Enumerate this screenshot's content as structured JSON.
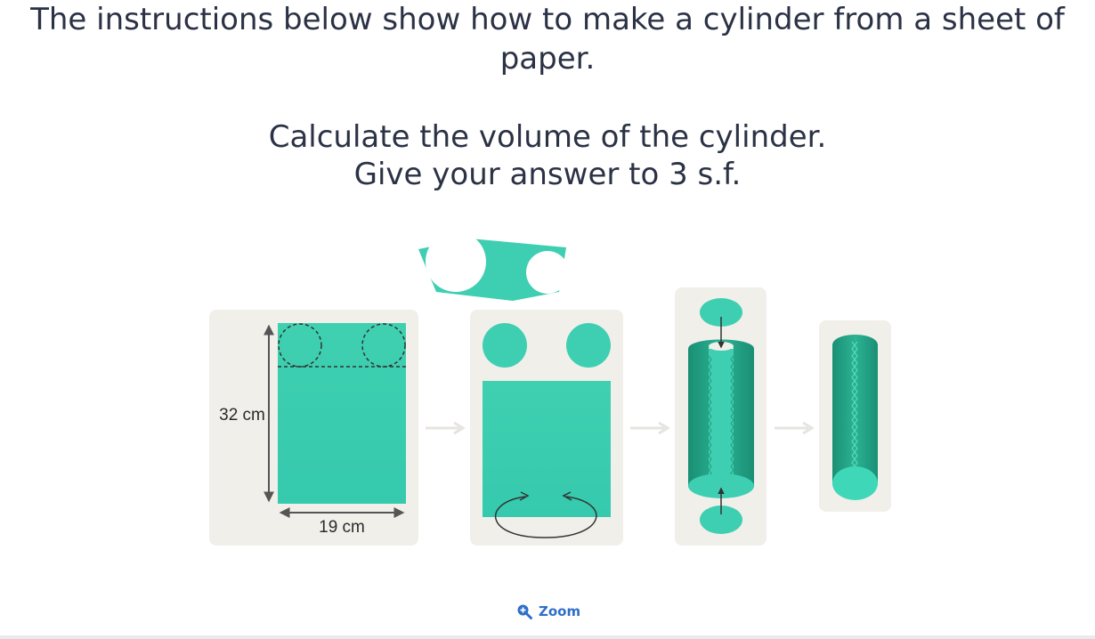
{
  "question": {
    "line1": "The instructions below show how to make a cylinder from a sheet of",
    "line2": "paper.",
    "line3": "Calculate the volume of the cylinder.",
    "line4": "Give your answer to 3 s.f."
  },
  "figure": {
    "height_label": "32 cm",
    "width_label": "19 cm"
  },
  "zoom": {
    "label": "Zoom",
    "icon": "zoom-in-icon"
  },
  "colors": {
    "accent": "#3ecfb2",
    "accent_dark": "#1f9c80",
    "panel": "#f1efea",
    "link": "#2e6fc9"
  }
}
